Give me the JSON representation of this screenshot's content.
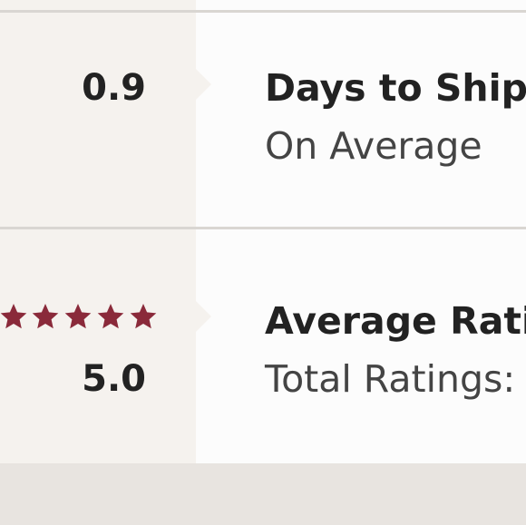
{
  "shipping": {
    "value": "0.9",
    "heading": "Days to Ship",
    "subtext": "On Average"
  },
  "rating": {
    "value": "5.0",
    "stars": 5,
    "heading": "Average Rating",
    "subtext": "Total Ratings:"
  },
  "colors": {
    "star": "#8a2a3a"
  }
}
